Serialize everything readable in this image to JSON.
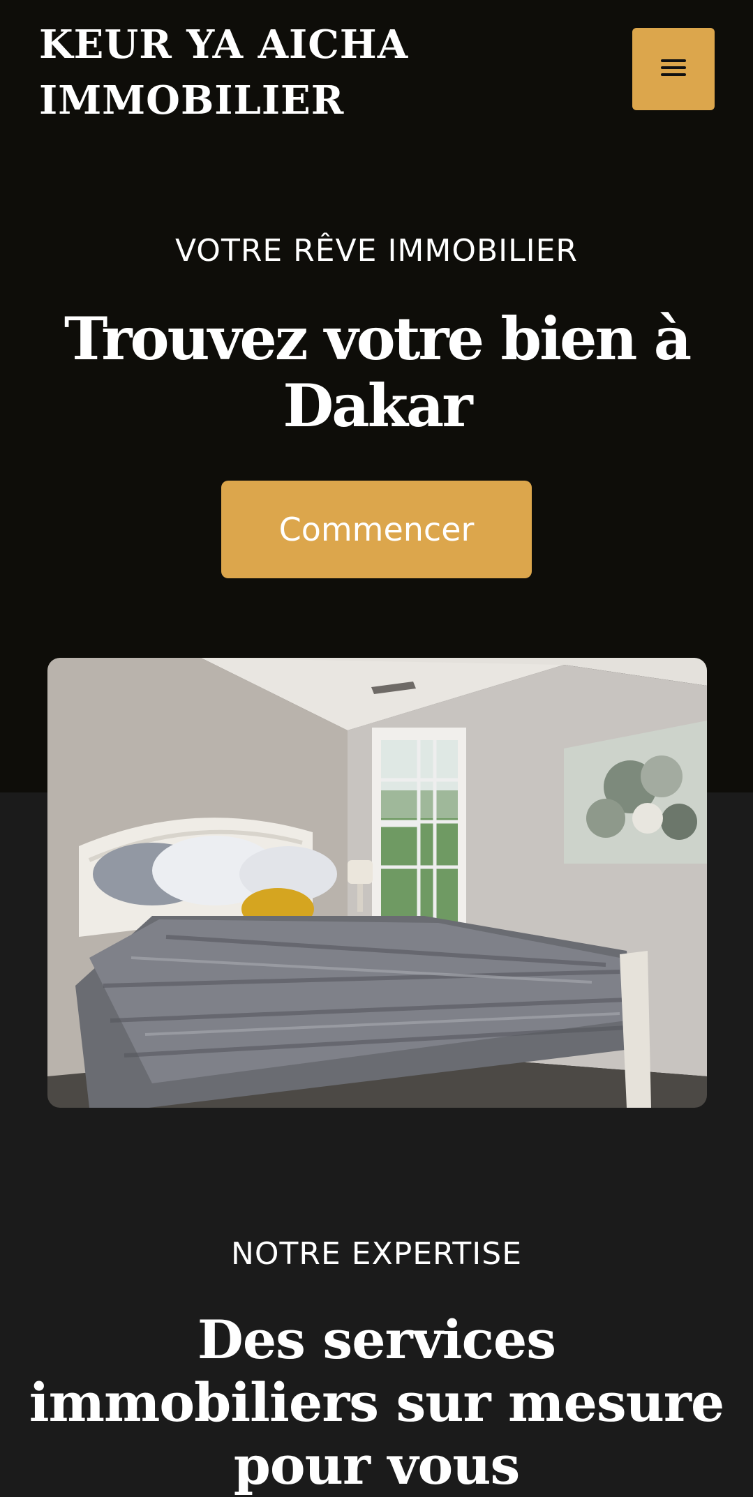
{
  "header": {
    "title": "KEUR YA AICHA IMMOBILIER",
    "menu_icon": "menu-icon"
  },
  "hero": {
    "eyebrow": "VOTRE RÊVE IMMOBILIER",
    "title": "Trouvez votre bien à Dakar",
    "cta_label": "Commencer",
    "image_subject": "bedroom-photo"
  },
  "services": {
    "eyebrow": "NOTRE EXPERTISE",
    "title": "Des services immobiliers sur mesure pour vous"
  },
  "colors": {
    "hero_background": "#0e0d09",
    "page_background": "#1b1b1b",
    "accent": "#dca64c",
    "text": "#ffffff"
  }
}
